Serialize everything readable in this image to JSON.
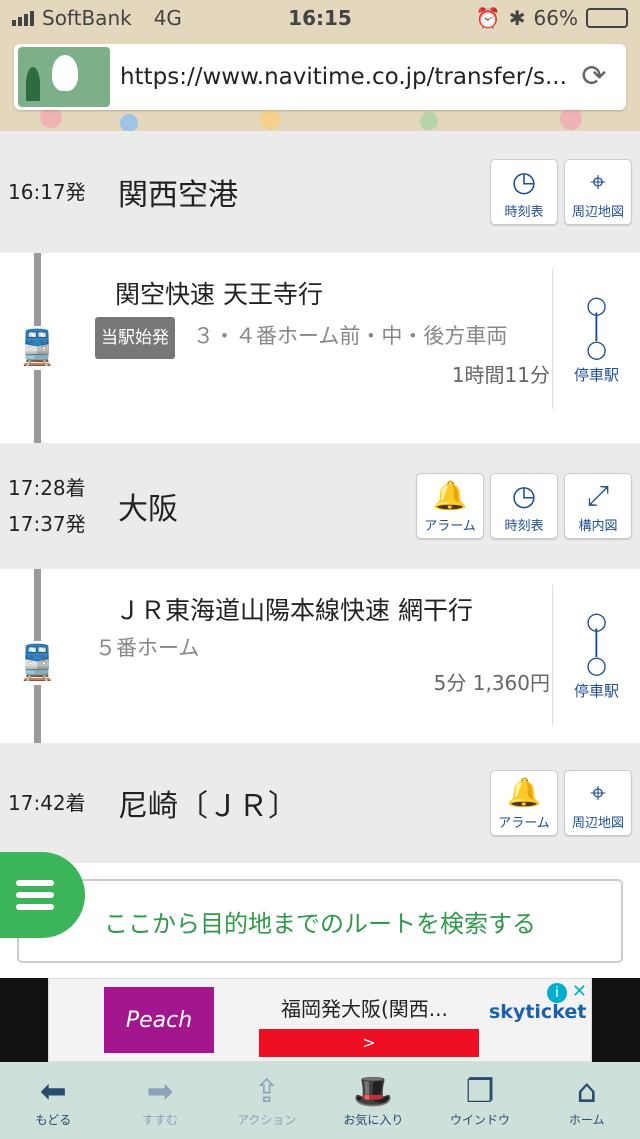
{
  "status_bar": {
    "carrier": "SoftBank",
    "network": "4G",
    "time": "16:15",
    "battery": "66%"
  },
  "browser": {
    "url": "https://www.navitime.co.jp/transfer/s..."
  },
  "stations": [
    {
      "time_lines": [
        "16:17発"
      ],
      "name": "関西空港",
      "buttons": [
        {
          "icon": "clock-icon",
          "label": "時刻表"
        },
        {
          "icon": "map-pin-icon",
          "label": "周辺地図"
        }
      ]
    },
    {
      "time_lines": [
        "17:28着",
        "17:37発"
      ],
      "name": "大阪",
      "buttons": [
        {
          "icon": "bell-icon",
          "label": "アラーム"
        },
        {
          "icon": "clock-icon",
          "label": "時刻表"
        },
        {
          "icon": "escalator-icon",
          "label": "構内図"
        }
      ]
    },
    {
      "time_lines": [
        "17:42着"
      ],
      "name": "尼崎〔ＪＲ〕",
      "buttons": [
        {
          "icon": "bell-icon",
          "label": "アラーム"
        },
        {
          "icon": "map-pin-icon",
          "label": "周辺地図"
        }
      ]
    }
  ],
  "segments": [
    {
      "line": "関空快速 天王寺行",
      "badge": "当駅始発",
      "platform": "３・４番ホーム前・中・後方車両",
      "duration": "1時間11分",
      "stops_label": "停車駅"
    },
    {
      "line": "ＪＲ東海道山陽本線快速 網干行",
      "platform": "５番ホーム",
      "duration": "5分 1,360円",
      "stops_label": "停車駅"
    }
  ],
  "search_route_label": "ここから目的地までのルートを検索する",
  "ad": {
    "brand": "Peach",
    "title": "福岡発大阪(関西...",
    "button": ">",
    "sponsor": "skyticket"
  },
  "toolbar": [
    {
      "icon": "back-arrow-icon",
      "label": "もどる"
    },
    {
      "icon": "forward-arrow-icon",
      "label": "すすむ"
    },
    {
      "icon": "share-icon",
      "label": "アクション"
    },
    {
      "icon": "hat-icon",
      "label": "お気に入り"
    },
    {
      "icon": "windows-icon",
      "label": "ウインドウ"
    },
    {
      "icon": "home-icon",
      "label": "ホーム"
    }
  ]
}
